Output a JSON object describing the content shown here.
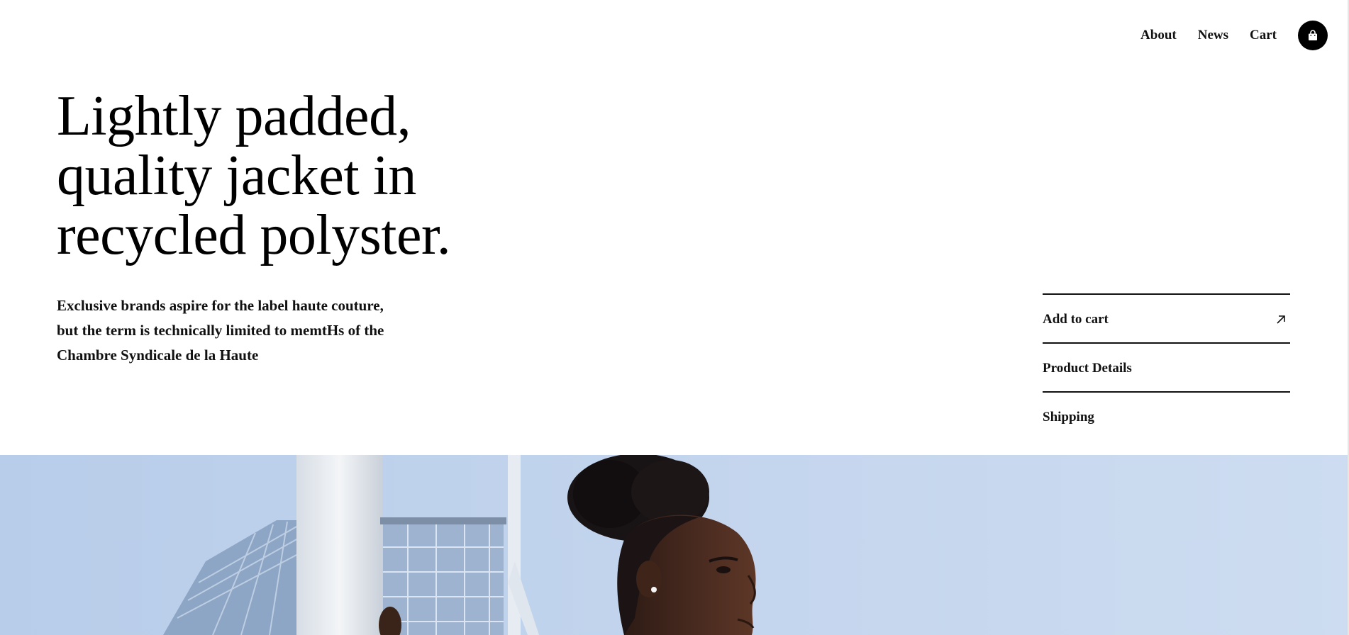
{
  "header": {
    "nav": {
      "about": "About",
      "news": "News",
      "cart": "Cart"
    },
    "cart_icon": "shopping-bag-icon"
  },
  "hero": {
    "headline": "Lightly padded, quality jacket in recycled polyster.",
    "description": "Exclusive brands aspire for the label haute couture, but the term is technically limited to memtHs of the Chambre Syndicale de la Haute"
  },
  "actions": {
    "add_to_cart": "Add to cart",
    "add_to_cart_icon": "arrow-up-right-icon",
    "product_details": "Product Details",
    "shipping": "Shipping"
  },
  "image": {
    "subject": "woman-with-hair-bun-outdoors-photo",
    "sky_color": "#c3d6ee"
  }
}
